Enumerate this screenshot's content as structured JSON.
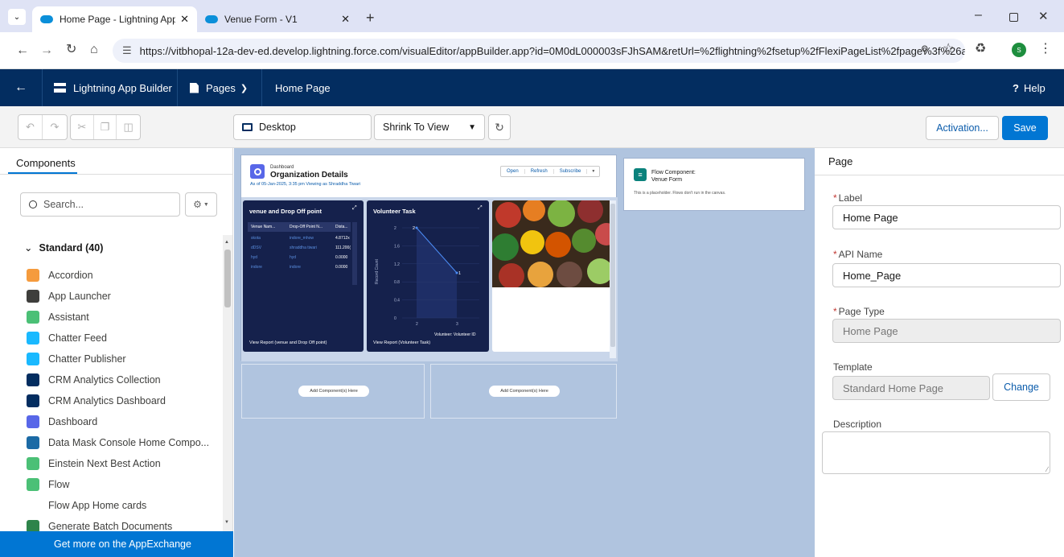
{
  "browser": {
    "tabs": [
      {
        "title": "Home Page - Lightning App Bu",
        "active": true
      },
      {
        "title": "Venue Form - V1",
        "active": false
      }
    ],
    "url": "https://vitbhopal-12a-dev-ed.develop.lightning.force.com/visualEditor/appBuilder.app?id=0M0dL000003sFJhSAM&retUrl=%2flightning%2fsetup%2fFlexiPageList%2fpage%3f%26ad...",
    "profile_initial": "S"
  },
  "header": {
    "app_name": "Lightning App Builder",
    "pages_label": "Pages",
    "page_name": "Home Page",
    "help_label": "Help"
  },
  "toolbar": {
    "device": "Desktop",
    "view_mode": "Shrink To View",
    "activation_label": "Activation...",
    "save_label": "Save"
  },
  "left": {
    "tab_label": "Components",
    "search_placeholder": "Search...",
    "section_label": "Standard (40)",
    "components": [
      {
        "label": "Accordion",
        "icon": "accordion-icon",
        "color": "#f59b3d"
      },
      {
        "label": "App Launcher",
        "icon": "app-launcher-icon",
        "color": "#3e3e3c"
      },
      {
        "label": "Assistant",
        "icon": "assistant-icon",
        "color": "#4bc076"
      },
      {
        "label": "Chatter Feed",
        "icon": "chatter-feed-icon",
        "color": "#1ab9ff"
      },
      {
        "label": "Chatter Publisher",
        "icon": "chatter-publisher-icon",
        "color": "#1ab9ff"
      },
      {
        "label": "CRM Analytics Collection",
        "icon": "analytics-icon",
        "color": "#032d60"
      },
      {
        "label": "CRM Analytics Dashboard",
        "icon": "analytics-icon",
        "color": "#032d60"
      },
      {
        "label": "Dashboard",
        "icon": "dashboard-icon",
        "color": "#5867e8"
      },
      {
        "label": "Data Mask Console Home Compo...",
        "icon": "data-mask-icon",
        "color": "#1b6aa5"
      },
      {
        "label": "Einstein Next Best Action",
        "icon": "einstein-icon",
        "color": "#4bc076"
      },
      {
        "label": "Flow",
        "icon": "flow-icon",
        "color": "#4bc076"
      },
      {
        "label": "Flow App Home cards",
        "icon": "",
        "color": ""
      },
      {
        "label": "Generate Batch Documents",
        "icon": "batch-docs-icon",
        "color": "#2e844a"
      }
    ],
    "appexchange_label": "Get more on the AppExchange"
  },
  "canvas": {
    "dashboard": {
      "type_label": "Dashboard",
      "title": "Organization Details",
      "subtitle": "As of 05-Jan-2025, 3:35 pm Viewing as Shraddha Tiwari",
      "buttons": [
        "Open",
        "Refresh",
        "Subscribe"
      ]
    },
    "table_card": {
      "title": "venue and Drop Off point",
      "columns": [
        "Venue Nam...",
        "Drop-Off Point N...",
        "Dista..."
      ],
      "rows": [
        [
          "skota",
          "indore_mhow",
          "4.8712x"
        ],
        [
          "dDSV",
          "shraddha tiwari",
          "111.200("
        ],
        [
          "hyd",
          "hyd",
          "0.0000"
        ],
        [
          "indore",
          "indore",
          "0.0000"
        ]
      ],
      "footer": "View Report (venue and Drop Off point)"
    },
    "chart_card": {
      "title": "Volunteer Task",
      "footer": "View Report (Volunteer Task)"
    },
    "chart_data": {
      "type": "line",
      "title": "Volunteer Task",
      "xlabel": "Volunteer: Volunteer ID",
      "ylabel": "Record Count",
      "x": [
        "2",
        "3"
      ],
      "values": [
        2,
        1
      ],
      "data_labels": [
        "2",
        "1"
      ],
      "yticks": [
        "0",
        "0.4",
        "0.8",
        "1.2",
        "1.6",
        "2"
      ],
      "ylim": [
        0,
        2
      ]
    },
    "flow": {
      "title": "Flow Component:",
      "name": "Venue Form",
      "note": "This is a placeholder. Flows don't run in the canvas."
    },
    "add_component_label": "Add Component(s) Here"
  },
  "right": {
    "panel_title": "Page",
    "label_field": {
      "label": "Label",
      "value": "Home Page"
    },
    "api_field": {
      "label": "API Name",
      "value": "Home_Page"
    },
    "type_field": {
      "label": "Page Type",
      "value": "Home Page"
    },
    "template_label": "Template",
    "template_value": "Standard Home Page",
    "change_label": "Change",
    "description_label": "Description",
    "required_marker": "*"
  }
}
